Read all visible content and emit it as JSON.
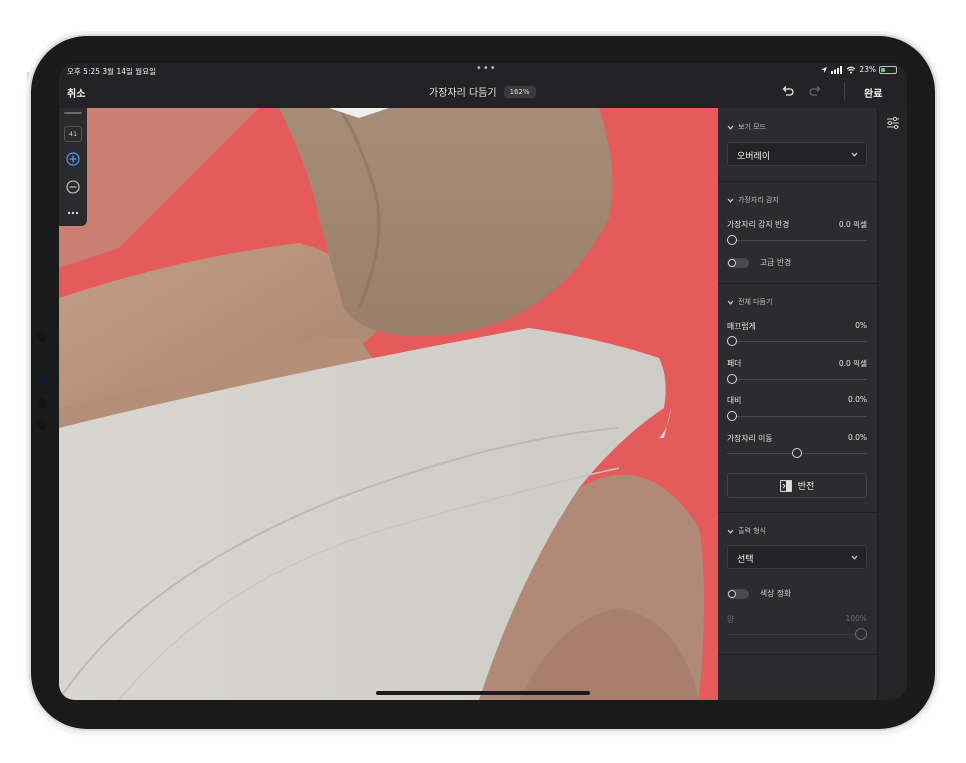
{
  "status_bar": {
    "time_date": "오후 5:25   3월 14일 월요일",
    "center_dots": "•••",
    "battery_pct": "23%"
  },
  "top_bar": {
    "cancel_label": "취소",
    "title": "가장자리 다듬기",
    "zoom": "162%",
    "done_label": "완료"
  },
  "toolstrip": {
    "brush_size": "41"
  },
  "panel": {
    "view_mode": {
      "header": "보기 모드",
      "selected": "오버레이"
    },
    "edge_detection": {
      "header": "가장자리 감지",
      "radius_label": "가장자리 감지 반경",
      "radius_value": "0.0 픽셀",
      "radius_fraction": 0.0,
      "smart_radius_label": "고급 반경"
    },
    "global_refine": {
      "header": "전체 다듬기",
      "smooth_label": "매끄럽게",
      "smooth_value": "0%",
      "feather_label": "페더",
      "feather_value": "0.0 픽셀",
      "contrast_label": "대비",
      "contrast_value": "0.0%",
      "shift_edge_label": "가장자리 이동",
      "shift_edge_value": "0.0%",
      "invert_label": "반전"
    },
    "output": {
      "header": "출력 형식",
      "selected": "선택",
      "decontaminate_label": "색상 정화",
      "amount_label": "양",
      "amount_value": "100%"
    }
  },
  "colors": {
    "overlay_red": "#e55a5a",
    "panel_bg": "#2c2c2e",
    "accent_blue": "#4a9dff"
  }
}
